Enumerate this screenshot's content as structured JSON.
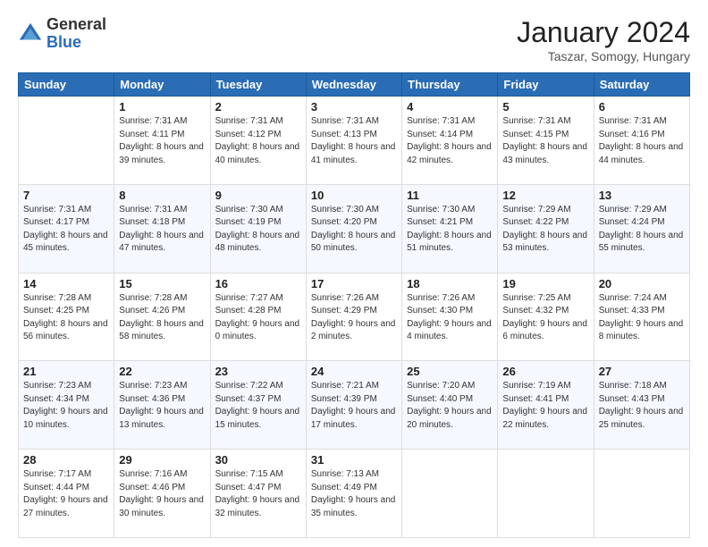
{
  "logo": {
    "general": "General",
    "blue": "Blue"
  },
  "header": {
    "title": "January 2024",
    "subtitle": "Taszar, Somogy, Hungary"
  },
  "calendar": {
    "columns": [
      "Sunday",
      "Monday",
      "Tuesday",
      "Wednesday",
      "Thursday",
      "Friday",
      "Saturday"
    ],
    "weeks": [
      [
        {
          "day": "",
          "sunrise": "",
          "sunset": "",
          "daylight": ""
        },
        {
          "day": "1",
          "sunrise": "Sunrise: 7:31 AM",
          "sunset": "Sunset: 4:11 PM",
          "daylight": "Daylight: 8 hours and 39 minutes."
        },
        {
          "day": "2",
          "sunrise": "Sunrise: 7:31 AM",
          "sunset": "Sunset: 4:12 PM",
          "daylight": "Daylight: 8 hours and 40 minutes."
        },
        {
          "day": "3",
          "sunrise": "Sunrise: 7:31 AM",
          "sunset": "Sunset: 4:13 PM",
          "daylight": "Daylight: 8 hours and 41 minutes."
        },
        {
          "day": "4",
          "sunrise": "Sunrise: 7:31 AM",
          "sunset": "Sunset: 4:14 PM",
          "daylight": "Daylight: 8 hours and 42 minutes."
        },
        {
          "day": "5",
          "sunrise": "Sunrise: 7:31 AM",
          "sunset": "Sunset: 4:15 PM",
          "daylight": "Daylight: 8 hours and 43 minutes."
        },
        {
          "day": "6",
          "sunrise": "Sunrise: 7:31 AM",
          "sunset": "Sunset: 4:16 PM",
          "daylight": "Daylight: 8 hours and 44 minutes."
        }
      ],
      [
        {
          "day": "7",
          "sunrise": "Sunrise: 7:31 AM",
          "sunset": "Sunset: 4:17 PM",
          "daylight": "Daylight: 8 hours and 45 minutes."
        },
        {
          "day": "8",
          "sunrise": "Sunrise: 7:31 AM",
          "sunset": "Sunset: 4:18 PM",
          "daylight": "Daylight: 8 hours and 47 minutes."
        },
        {
          "day": "9",
          "sunrise": "Sunrise: 7:30 AM",
          "sunset": "Sunset: 4:19 PM",
          "daylight": "Daylight: 8 hours and 48 minutes."
        },
        {
          "day": "10",
          "sunrise": "Sunrise: 7:30 AM",
          "sunset": "Sunset: 4:20 PM",
          "daylight": "Daylight: 8 hours and 50 minutes."
        },
        {
          "day": "11",
          "sunrise": "Sunrise: 7:30 AM",
          "sunset": "Sunset: 4:21 PM",
          "daylight": "Daylight: 8 hours and 51 minutes."
        },
        {
          "day": "12",
          "sunrise": "Sunrise: 7:29 AM",
          "sunset": "Sunset: 4:22 PM",
          "daylight": "Daylight: 8 hours and 53 minutes."
        },
        {
          "day": "13",
          "sunrise": "Sunrise: 7:29 AM",
          "sunset": "Sunset: 4:24 PM",
          "daylight": "Daylight: 8 hours and 55 minutes."
        }
      ],
      [
        {
          "day": "14",
          "sunrise": "Sunrise: 7:28 AM",
          "sunset": "Sunset: 4:25 PM",
          "daylight": "Daylight: 8 hours and 56 minutes."
        },
        {
          "day": "15",
          "sunrise": "Sunrise: 7:28 AM",
          "sunset": "Sunset: 4:26 PM",
          "daylight": "Daylight: 8 hours and 58 minutes."
        },
        {
          "day": "16",
          "sunrise": "Sunrise: 7:27 AM",
          "sunset": "Sunset: 4:28 PM",
          "daylight": "Daylight: 9 hours and 0 minutes."
        },
        {
          "day": "17",
          "sunrise": "Sunrise: 7:26 AM",
          "sunset": "Sunset: 4:29 PM",
          "daylight": "Daylight: 9 hours and 2 minutes."
        },
        {
          "day": "18",
          "sunrise": "Sunrise: 7:26 AM",
          "sunset": "Sunset: 4:30 PM",
          "daylight": "Daylight: 9 hours and 4 minutes."
        },
        {
          "day": "19",
          "sunrise": "Sunrise: 7:25 AM",
          "sunset": "Sunset: 4:32 PM",
          "daylight": "Daylight: 9 hours and 6 minutes."
        },
        {
          "day": "20",
          "sunrise": "Sunrise: 7:24 AM",
          "sunset": "Sunset: 4:33 PM",
          "daylight": "Daylight: 9 hours and 8 minutes."
        }
      ],
      [
        {
          "day": "21",
          "sunrise": "Sunrise: 7:23 AM",
          "sunset": "Sunset: 4:34 PM",
          "daylight": "Daylight: 9 hours and 10 minutes."
        },
        {
          "day": "22",
          "sunrise": "Sunrise: 7:23 AM",
          "sunset": "Sunset: 4:36 PM",
          "daylight": "Daylight: 9 hours and 13 minutes."
        },
        {
          "day": "23",
          "sunrise": "Sunrise: 7:22 AM",
          "sunset": "Sunset: 4:37 PM",
          "daylight": "Daylight: 9 hours and 15 minutes."
        },
        {
          "day": "24",
          "sunrise": "Sunrise: 7:21 AM",
          "sunset": "Sunset: 4:39 PM",
          "daylight": "Daylight: 9 hours and 17 minutes."
        },
        {
          "day": "25",
          "sunrise": "Sunrise: 7:20 AM",
          "sunset": "Sunset: 4:40 PM",
          "daylight": "Daylight: 9 hours and 20 minutes."
        },
        {
          "day": "26",
          "sunrise": "Sunrise: 7:19 AM",
          "sunset": "Sunset: 4:41 PM",
          "daylight": "Daylight: 9 hours and 22 minutes."
        },
        {
          "day": "27",
          "sunrise": "Sunrise: 7:18 AM",
          "sunset": "Sunset: 4:43 PM",
          "daylight": "Daylight: 9 hours and 25 minutes."
        }
      ],
      [
        {
          "day": "28",
          "sunrise": "Sunrise: 7:17 AM",
          "sunset": "Sunset: 4:44 PM",
          "daylight": "Daylight: 9 hours and 27 minutes."
        },
        {
          "day": "29",
          "sunrise": "Sunrise: 7:16 AM",
          "sunset": "Sunset: 4:46 PM",
          "daylight": "Daylight: 9 hours and 30 minutes."
        },
        {
          "day": "30",
          "sunrise": "Sunrise: 7:15 AM",
          "sunset": "Sunset: 4:47 PM",
          "daylight": "Daylight: 9 hours and 32 minutes."
        },
        {
          "day": "31",
          "sunrise": "Sunrise: 7:13 AM",
          "sunset": "Sunset: 4:49 PM",
          "daylight": "Daylight: 9 hours and 35 minutes."
        },
        {
          "day": "",
          "sunrise": "",
          "sunset": "",
          "daylight": ""
        },
        {
          "day": "",
          "sunrise": "",
          "sunset": "",
          "daylight": ""
        },
        {
          "day": "",
          "sunrise": "",
          "sunset": "",
          "daylight": ""
        }
      ]
    ]
  }
}
